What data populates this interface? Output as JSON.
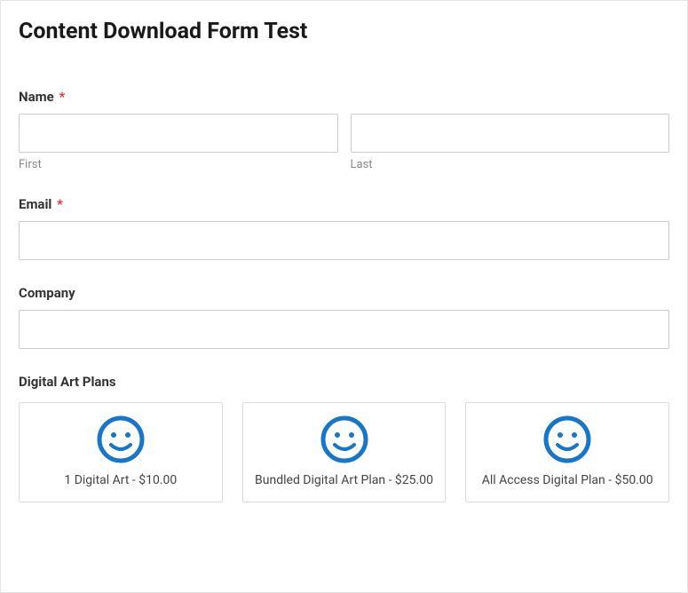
{
  "header": {
    "title": "Content Download Form Test"
  },
  "fields": {
    "name": {
      "label": "Name",
      "required": "*",
      "first_sublabel": "First",
      "last_sublabel": "Last"
    },
    "email": {
      "label": "Email",
      "required": "*"
    },
    "company": {
      "label": "Company"
    }
  },
  "plans": {
    "label": "Digital Art Plans",
    "items": [
      {
        "label": "1 Digital Art - $10.00"
      },
      {
        "label": "Bundled Digital Art Plan - $25.00"
      },
      {
        "label": "All Access Digital Plan - $50.00"
      }
    ]
  },
  "colors": {
    "accent": "#1876c9"
  }
}
